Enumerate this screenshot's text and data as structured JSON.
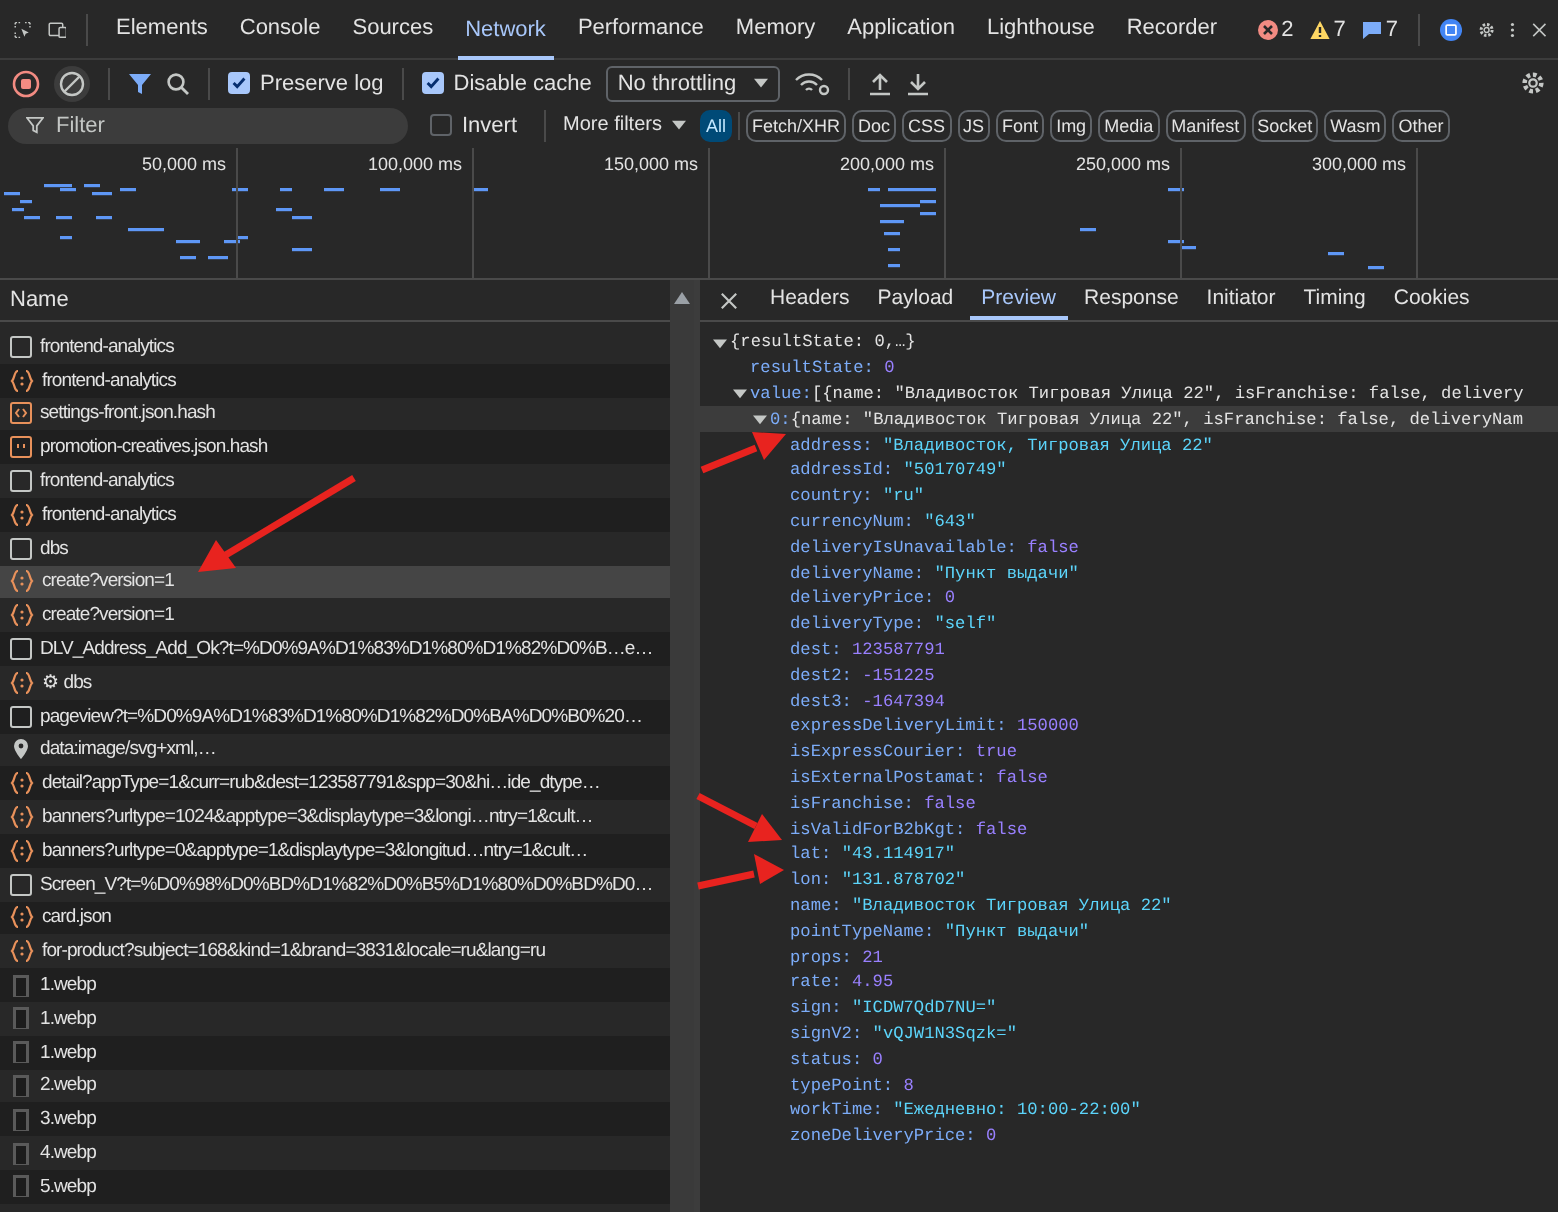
{
  "main_tabs": [
    {
      "label": "Elements",
      "selected": false
    },
    {
      "label": "Console",
      "selected": false
    },
    {
      "label": "Sources",
      "selected": false
    },
    {
      "label": "Network",
      "selected": true
    },
    {
      "label": "Performance",
      "selected": false
    },
    {
      "label": "Memory",
      "selected": false
    },
    {
      "label": "Application",
      "selected": false
    },
    {
      "label": "Lighthouse",
      "selected": false
    },
    {
      "label": "Recorder",
      "selected": false
    }
  ],
  "counters": {
    "errors": "2",
    "warnings": "7",
    "messages": "7"
  },
  "toolbar": {
    "preserve_log": {
      "label": "Preserve log",
      "checked": true
    },
    "disable_cache": {
      "label": "Disable cache",
      "checked": true
    },
    "throttling": "No throttling"
  },
  "filter_bar": {
    "placeholder": "Filter",
    "invert": {
      "label": "Invert",
      "checked": false
    },
    "more_filters": "More filters",
    "types": [
      {
        "label": "All",
        "selected": true
      },
      {
        "label": "Fetch/XHR",
        "selected": false
      },
      {
        "label": "Doc",
        "selected": false
      },
      {
        "label": "CSS",
        "selected": false
      },
      {
        "label": "JS",
        "selected": false
      },
      {
        "label": "Font",
        "selected": false
      },
      {
        "label": "Img",
        "selected": false
      },
      {
        "label": "Media",
        "selected": false
      },
      {
        "label": "Manifest",
        "selected": false
      },
      {
        "label": "Socket",
        "selected": false
      },
      {
        "label": "Wasm",
        "selected": false
      },
      {
        "label": "Other",
        "selected": false
      }
    ]
  },
  "timeline": {
    "ticks": [
      "50,000 ms",
      "100,000 ms",
      "150,000 ms",
      "200,000 ms",
      "250,000 ms",
      "300,000 ms"
    ]
  },
  "requests": {
    "column": "Name",
    "rows": [
      {
        "name": "frontend-analytics",
        "kind": "doc",
        "selected": false
      },
      {
        "name": "frontend-analytics",
        "kind": "fetch",
        "selected": false
      },
      {
        "name": "settings-front.json.hash",
        "kind": "script",
        "selected": false
      },
      {
        "name": "promotion-creatives.json.hash",
        "kind": "json",
        "selected": false
      },
      {
        "name": "frontend-analytics",
        "kind": "doc",
        "selected": false
      },
      {
        "name": "frontend-analytics",
        "kind": "fetch",
        "selected": false
      },
      {
        "name": "dbs",
        "kind": "doc",
        "selected": false
      },
      {
        "name": "create?version=1",
        "kind": "fetch",
        "selected": true
      },
      {
        "name": "create?version=1",
        "kind": "fetch",
        "selected": false
      },
      {
        "name": "DLV_Address_Add_Ok?t=%D0%9A%D1%83%D1%80%D1%82%D0%B…e…",
        "kind": "doc",
        "selected": false
      },
      {
        "name": "⚙ dbs",
        "kind": "fetch",
        "selected": false
      },
      {
        "name": "pageview?t=%D0%9A%D1%83%D1%80%D1%82%D0%BA%D0%B0%20…",
        "kind": "doc",
        "selected": false
      },
      {
        "name": "data:image/svg+xml,…",
        "kind": "pin",
        "selected": false
      },
      {
        "name": "detail?appType=1&curr=rub&dest=123587791&spp=30&hi…ide_dtype…",
        "kind": "fetch",
        "selected": false
      },
      {
        "name": "banners?urltype=1024&apptype=3&displaytype=3&longi…ntry=1&cult…",
        "kind": "fetch",
        "selected": false
      },
      {
        "name": "banners?urltype=0&apptype=1&displaytype=3&longitud…ntry=1&cult…",
        "kind": "fetch",
        "selected": false
      },
      {
        "name": "Screen_V?t=%D0%98%D0%BD%D1%82%D0%B5%D1%80%D0%BD%D0…",
        "kind": "doc",
        "selected": false
      },
      {
        "name": "card.json",
        "kind": "fetch",
        "selected": false
      },
      {
        "name": "for-product?subject=168&kind=1&brand=3831&locale=ru&lang=ru",
        "kind": "fetch",
        "selected": false
      },
      {
        "name": "1.webp",
        "kind": "image",
        "selected": false
      },
      {
        "name": "1.webp",
        "kind": "image",
        "selected": false
      },
      {
        "name": "1.webp",
        "kind": "image",
        "selected": false
      },
      {
        "name": "2.webp",
        "kind": "image",
        "selected": false
      },
      {
        "name": "3.webp",
        "kind": "image",
        "selected": false
      },
      {
        "name": "4.webp",
        "kind": "image",
        "selected": false
      },
      {
        "name": "5.webp",
        "kind": "image",
        "selected": false
      }
    ]
  },
  "detail_tabs": [
    {
      "label": "Headers",
      "selected": false
    },
    {
      "label": "Payload",
      "selected": false
    },
    {
      "label": "Preview",
      "selected": true
    },
    {
      "label": "Response",
      "selected": false
    },
    {
      "label": "Initiator",
      "selected": false
    },
    {
      "label": "Timing",
      "selected": false
    },
    {
      "label": "Cookies",
      "selected": false
    }
  ],
  "preview": {
    "tree": [
      {
        "kind": "object",
        "label": "{resultState: 0,…}",
        "expanded": true,
        "selected": false,
        "children": [
          {
            "kind": "number",
            "key": "resultState:",
            "value": "0"
          },
          {
            "kind": "object",
            "key": "value:",
            "label": "[{name: \"Владивосток Тигровая Улица 22\", isFranchise: false, delivery",
            "expanded": true,
            "selected": false,
            "children": [
              {
                "kind": "object",
                "key": "0:",
                "label": "{name: \"Владивосток Тигровая Улица 22\", isFranchise: false, deliveryNam",
                "expanded": true,
                "selected": true,
                "children": [
                  {
                    "kind": "string",
                    "key": "address:",
                    "value": "\"Владивосток, Тигровая Улица 22\""
                  },
                  {
                    "kind": "string",
                    "key": "addressId:",
                    "value": "\"50170749\""
                  },
                  {
                    "kind": "string",
                    "key": "country:",
                    "value": "\"ru\""
                  },
                  {
                    "kind": "string",
                    "key": "currencyNum:",
                    "value": "\"643\""
                  },
                  {
                    "kind": "boolean",
                    "key": "deliveryIsUnavailable:",
                    "value": "false"
                  },
                  {
                    "kind": "string",
                    "key": "deliveryName:",
                    "value": "\"Пункт выдачи\""
                  },
                  {
                    "kind": "number",
                    "key": "deliveryPrice:",
                    "value": "0"
                  },
                  {
                    "kind": "string",
                    "key": "deliveryType:",
                    "value": "\"self\""
                  },
                  {
                    "kind": "number",
                    "key": "dest:",
                    "value": "123587791"
                  },
                  {
                    "kind": "number",
                    "key": "dest2:",
                    "value": "-151225"
                  },
                  {
                    "kind": "number",
                    "key": "dest3:",
                    "value": "-1647394"
                  },
                  {
                    "kind": "number",
                    "key": "expressDeliveryLimit:",
                    "value": "150000"
                  },
                  {
                    "kind": "boolean",
                    "key": "isExpressCourier:",
                    "value": "true"
                  },
                  {
                    "kind": "boolean",
                    "key": "isExternalPostamat:",
                    "value": "false"
                  },
                  {
                    "kind": "boolean",
                    "key": "isFranchise:",
                    "value": "false"
                  },
                  {
                    "kind": "boolean",
                    "key": "isValidForB2bKgt:",
                    "value": "false"
                  },
                  {
                    "kind": "string",
                    "key": "lat:",
                    "value": "\"43.114917\""
                  },
                  {
                    "kind": "string",
                    "key": "lon:",
                    "value": "\"131.878702\""
                  },
                  {
                    "kind": "string",
                    "key": "name:",
                    "value": "\"Владивосток Тигровая Улица 22\""
                  },
                  {
                    "kind": "string",
                    "key": "pointTypeName:",
                    "value": "\"Пункт выдачи\""
                  },
                  {
                    "kind": "number",
                    "key": "props:",
                    "value": "21"
                  },
                  {
                    "kind": "number",
                    "key": "rate:",
                    "value": "4.95"
                  },
                  {
                    "kind": "string",
                    "key": "sign:",
                    "value": "\"ICDW7QdD7NU=\""
                  },
                  {
                    "kind": "string",
                    "key": "signV2:",
                    "value": "\"vQJW1N3Sqzk=\""
                  },
                  {
                    "kind": "number",
                    "key": "status:",
                    "value": "0"
                  },
                  {
                    "kind": "number",
                    "key": "typePoint:",
                    "value": "8"
                  },
                  {
                    "kind": "string",
                    "key": "workTime:",
                    "value": "\"Ежедневно: 10:00-22:00\""
                  },
                  {
                    "kind": "number",
                    "key": "zoneDeliveryPrice:",
                    "value": "0"
                  }
                ]
              }
            ]
          }
        ]
      }
    ]
  }
}
